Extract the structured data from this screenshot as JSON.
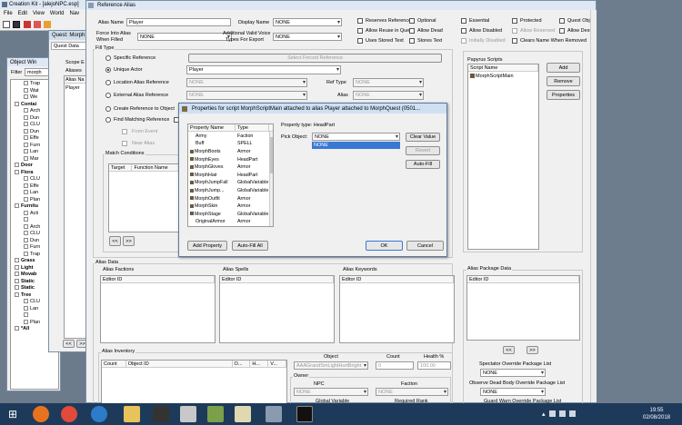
{
  "main_window": {
    "title": "Creation Kit - [alejoNPC.esp]",
    "menu": [
      "File",
      "Edit",
      "View",
      "World",
      "Nav"
    ]
  },
  "quest_window": {
    "title": "Quest: Morph",
    "tab": "Quest Data",
    "scope_label": "Scope E",
    "aliases_label": "Aliases",
    "aliases_header": "Alias Na",
    "alias_row": "Player"
  },
  "object_window": {
    "title": "Object Win",
    "filter_label": "Filter",
    "filter_value": "morph",
    "tree": [
      {
        "label": "Trap",
        "bold": false,
        "indent": 2
      },
      {
        "label": "Wat",
        "bold": false,
        "indent": 2
      },
      {
        "label": "We",
        "bold": false,
        "indent": 2
      },
      {
        "label": "Contai",
        "bold": true,
        "indent": 1
      },
      {
        "label": "Arch",
        "bold": false,
        "indent": 2
      },
      {
        "label": "Dun",
        "bold": false,
        "indent": 2
      },
      {
        "label": "CLU",
        "bold": false,
        "indent": 2
      },
      {
        "label": "Dun",
        "bold": false,
        "indent": 2
      },
      {
        "label": "Effe",
        "bold": false,
        "indent": 2
      },
      {
        "label": "Furn",
        "bold": false,
        "indent": 2
      },
      {
        "label": "Lan",
        "bold": false,
        "indent": 2
      },
      {
        "label": "Mar",
        "bold": false,
        "indent": 2
      },
      {
        "label": "Door",
        "bold": true,
        "indent": 1
      },
      {
        "label": "Flora",
        "bold": true,
        "indent": 1
      },
      {
        "label": "CLU",
        "bold": false,
        "indent": 2
      },
      {
        "label": "Effe",
        "bold": false,
        "indent": 2
      },
      {
        "label": "Lan",
        "bold": false,
        "indent": 2
      },
      {
        "label": "Plan",
        "bold": false,
        "indent": 2
      },
      {
        "label": "Furnitu",
        "bold": true,
        "indent": 1
      },
      {
        "label": "Acti",
        "bold": false,
        "indent": 2
      },
      {
        "label": "",
        "bold": false,
        "indent": 2
      },
      {
        "label": "Arch",
        "bold": false,
        "indent": 2
      },
      {
        "label": "CLU",
        "bold": false,
        "indent": 2
      },
      {
        "label": "Dun",
        "bold": false,
        "indent": 2
      },
      {
        "label": "Furn",
        "bold": false,
        "indent": 2
      },
      {
        "label": "Trap",
        "bold": false,
        "indent": 2
      },
      {
        "label": "Grass",
        "bold": true,
        "indent": 1
      },
      {
        "label": "Light",
        "bold": true,
        "indent": 1
      },
      {
        "label": "Movab",
        "bold": true,
        "indent": 1
      },
      {
        "label": "Static",
        "bold": true,
        "indent": 1
      },
      {
        "label": "Static",
        "bold": true,
        "indent": 1
      },
      {
        "label": "Tree",
        "bold": true,
        "indent": 1
      },
      {
        "label": "CLU",
        "bold": false,
        "indent": 2
      },
      {
        "label": "Lan",
        "bold": false,
        "indent": 2
      },
      {
        "label": "",
        "bold": false,
        "indent": 2
      },
      {
        "label": "Plan",
        "bold": false,
        "indent": 2
      },
      {
        "label": "*All",
        "bold": true,
        "indent": 1
      }
    ],
    "nav_prev": "<<",
    "nav_next": ">>"
  },
  "alias_window": {
    "title": "Reference Alias",
    "alias_name_label": "Alias Name",
    "alias_name_value": "Player",
    "display_name_label": "Display Name",
    "display_name_value": "NONE",
    "force_into_alias_label1": "Force Into Alias",
    "force_into_alias_label2": "When Filled",
    "force_into_alias_value": "NONE",
    "voice_types_label1": "Additional Valid Voice",
    "voice_types_label2": "Types For Export",
    "voice_types_value": "NONE",
    "flags": [
      {
        "label": "Reserves Reference",
        "checked": false,
        "disabled": false
      },
      {
        "label": "Optional",
        "checked": false,
        "disabled": false
      },
      {
        "label": "Essential",
        "checked": false,
        "disabled": false
      },
      {
        "label": "Protected",
        "checked": false,
        "disabled": false
      },
      {
        "label": "Quest Object",
        "checked": false,
        "disabled": false
      },
      {
        "label": "Allow Reuse in Quest",
        "checked": false,
        "disabled": false
      },
      {
        "label": "Allow Dead",
        "checked": false,
        "disabled": false
      },
      {
        "label": "Allow Disabled",
        "checked": false,
        "disabled": false
      },
      {
        "label": "Allow Reserved",
        "checked": false,
        "disabled": true
      },
      {
        "label": "Allow Destroyed",
        "checked": false,
        "disabled": false
      },
      {
        "label": "Uses Stored Text",
        "checked": false,
        "disabled": false
      },
      {
        "label": "Stores Text",
        "checked": false,
        "disabled": false
      },
      {
        "label": "Initially Disabled",
        "checked": false,
        "disabled": true
      },
      {
        "label": "Clears Name When Removed",
        "checked": false,
        "disabled": false
      }
    ],
    "fill_type_label": "Fill Type",
    "specific_reference": "Specific Reference",
    "select_forced_reference": "Select Forced Reference",
    "unique_actor": "Unique Actor",
    "unique_actor_value": "Player",
    "location_alias_reference": "Location Alias Reference",
    "location_alias_value": "NONE",
    "ref_type_label": "Ref Type",
    "ref_type_value": "NONE",
    "external_alias_reference": "External Alias Reference",
    "external_alias_value": "NONE",
    "alias_label": "Alias",
    "alias_value": "NONE",
    "create_reference": "Create Reference to Object",
    "find_matching": "Find Matching Reference",
    "from_event": "From Event",
    "near_alias": "Near Alias",
    "match_conditions_label": "Match Conditions",
    "match_target_header": "Target",
    "match_function_header": "Function Name",
    "papyrus_label": "Papyrus Scripts",
    "script_name_header": "Script Name",
    "script_item": "MorphScriptMain",
    "add_button": "Add",
    "remove_button": "Remove",
    "properties_button": "Properties",
    "alias_data_label": "Alias Data",
    "alias_factions_label": "Alias Factions",
    "alias_spells_label": "Alias Spells",
    "alias_keywords_label": "Alias Keywords",
    "alias_package_data_label": "Alias Package Data",
    "editor_id_header": "Editor ID",
    "alias_inventory_label": "Alias Inventory",
    "inventory_headers": [
      "Count",
      "Object ID",
      "O...",
      "H...",
      "V..."
    ],
    "object_label": "Object",
    "object_value": "AAAGrandSmLightHurtBright",
    "count_label": "Count",
    "count_value": "0",
    "health_label": "Health %",
    "health_value": "100.00",
    "owner_label": "Owner",
    "npc_label": "NPC",
    "npc_value": "NONE",
    "faction_label": "Faction",
    "faction_value": "NONE",
    "global_variable_label": "Global Variable",
    "required_rank_label": "Required Rank",
    "spectator_label": "Spectator Override Package List",
    "spectator_value": "NONE",
    "observe_dead_label": "Observe Dead Body Override Package List",
    "observe_dead_value": "NONE",
    "guard_warn_label": "Guard Warn Override Package List",
    "nav_prev": "<<",
    "nav_next": ">>"
  },
  "properties_dialog": {
    "title": "Properties for script MorphScriptMain attached to alias Player attached to MorphQuest (0501...",
    "col_property": "Property Name",
    "col_type": "Type",
    "rows": [
      {
        "name": "Army",
        "type": "Faction",
        "icon": false
      },
      {
        "name": "Buff",
        "type": "SPELL",
        "icon": false
      },
      {
        "name": "MorphBoots",
        "type": "Armor",
        "icon": true
      },
      {
        "name": "MorphEyes",
        "type": "HeadPart",
        "icon": true
      },
      {
        "name": "MorphGloves",
        "type": "Armor",
        "icon": true
      },
      {
        "name": "MorphHair",
        "type": "HeadPart",
        "icon": true
      },
      {
        "name": "MorphJumpFall",
        "type": "GlobalVariable",
        "icon": true
      },
      {
        "name": "MorphJump...",
        "type": "GlobalVariable",
        "icon": true
      },
      {
        "name": "MorphOutfit",
        "type": "Armor",
        "icon": true
      },
      {
        "name": "MorphSkin",
        "type": "Armor",
        "icon": true
      },
      {
        "name": "MorphStage",
        "type": "GlobalVariable",
        "icon": true
      },
      {
        "name": "OriginalArmor",
        "type": "Armor",
        "icon": false
      }
    ],
    "property_type_text": "Property type: HeadPart",
    "pick_object_label": "Pick Object:",
    "pick_object_value": "NONE",
    "dropdown_option": "NONE",
    "clear_value": "Clear Value",
    "revert": "Revert",
    "auto_fill": "Auto-Fill",
    "add_property": "Add Property",
    "auto_fill_all": "Auto-Fill All",
    "ok": "OK",
    "cancel": "Cancel"
  },
  "taskbar": {
    "time": "19:55",
    "date": "02/08/2018"
  }
}
